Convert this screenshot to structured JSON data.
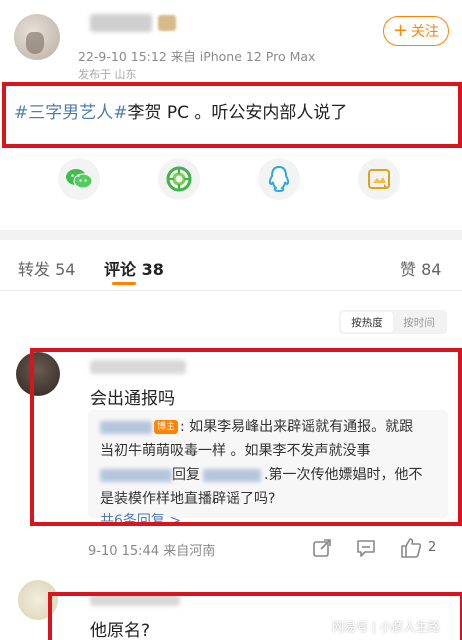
{
  "post": {
    "meta_line": "22-9-10 15:12  来自 iPhone 12 Pro Max",
    "meta_line2": "发布于 山东",
    "follow_plus": "+",
    "follow_label": "关注",
    "tag": "#三字男艺人#",
    "text_after_tag": "李贺 PC 。听公安内部人说了"
  },
  "share_icons": [
    "wechat-icon",
    "moments-icon",
    "qq-icon",
    "qzone-icon"
  ],
  "tabs": {
    "repost": "转发 54",
    "comments": "评论 38",
    "likes": "赞 84"
  },
  "sort": {
    "by_heat": "按热度",
    "by_time": "按时间"
  },
  "comment1": {
    "text": "会出通报吗",
    "badge": "博主",
    "reply_line1": ": 如果李易峰出来辟谣就有通报。就跟",
    "reply_line2": "当初牛萌萌吸毒一样 。如果李不发声就没事",
    "reply_line3a": "回复",
    "reply_line3b": ".第一次传他嫖娼时，他不",
    "reply_line4": "是装模作样地直播辟谣了吗?",
    "more_replies": "共6条回复 >",
    "footer": "9-10 15:44  来自河南",
    "likes": "2"
  },
  "comment2": {
    "text": "他原名?"
  },
  "watermark": "网易号 | 小彦人生路",
  "colors": {
    "accent": "#ff8200",
    "link": "#507daf",
    "highlight_box": "#d8141c"
  }
}
